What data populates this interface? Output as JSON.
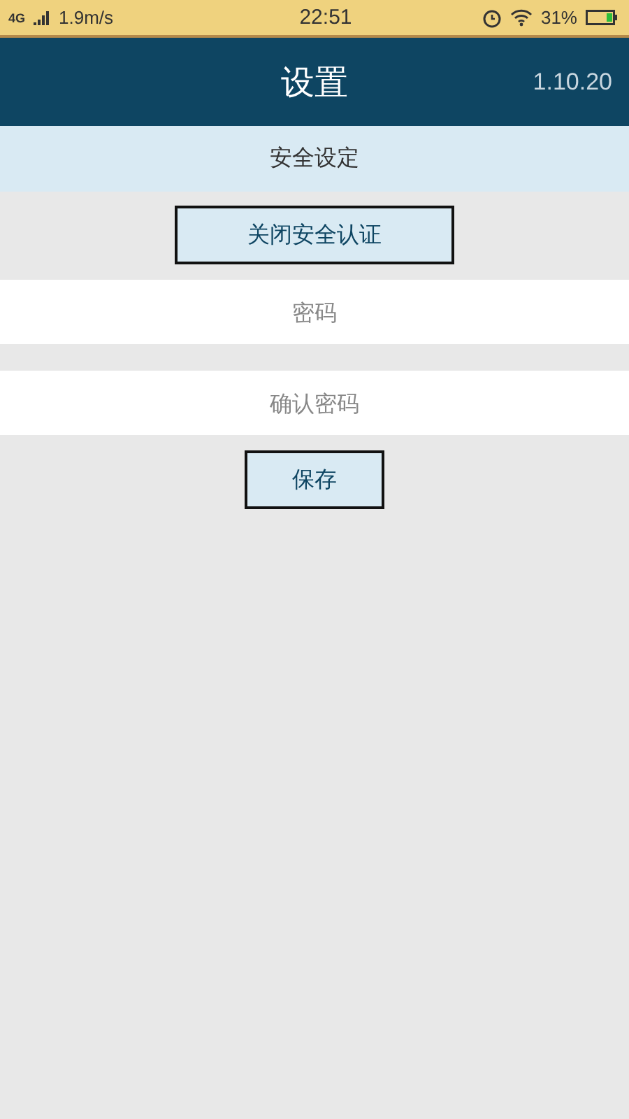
{
  "status_bar": {
    "network": "4G",
    "speed": "1.9m/s",
    "time": "22:51",
    "battery": "31%"
  },
  "header": {
    "title": "设置",
    "version": "1.10.20"
  },
  "section": {
    "title": "安全设定"
  },
  "toggle_button": "关闭安全认证",
  "fields": [
    {
      "placeholder": "密码"
    },
    {
      "placeholder": "确认密码"
    }
  ],
  "save_button": "保存"
}
